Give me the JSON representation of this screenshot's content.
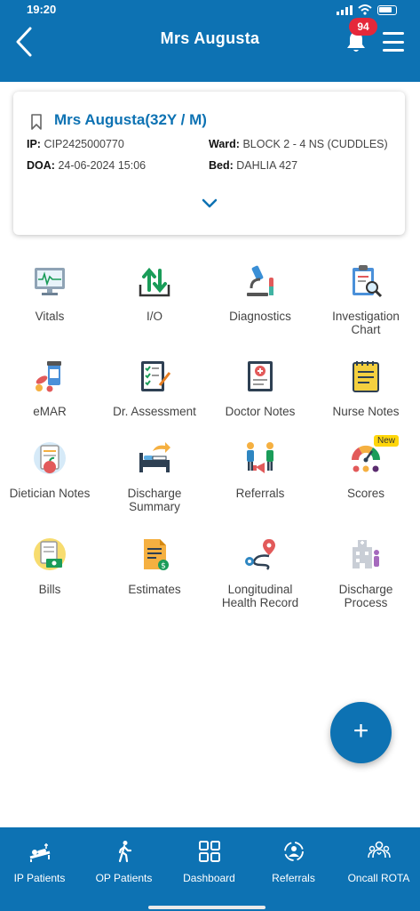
{
  "status_bar": {
    "time": "19:20"
  },
  "header": {
    "title": "Mrs Augusta",
    "notification_count": "94"
  },
  "patient": {
    "name": "Mrs Augusta(32Y / M)",
    "ip_label": "IP:",
    "ip_value": "CIP2425000770",
    "ward_label": "Ward:",
    "ward_value": "BLOCK 2 - 4 NS (CUDDLES)",
    "doa_label": "DOA:",
    "doa_value": "24-06-2024 15:06",
    "bed_label": "Bed:",
    "bed_value": "DAHLIA 427"
  },
  "grid": {
    "vitals": "Vitals",
    "io": "I/O",
    "diagnostics": "Diagnostics",
    "investigation_chart_1": "Investigation",
    "investigation_chart_2": "Chart",
    "emar": "eMAR",
    "dr_assessment": "Dr. Assessment",
    "doctor_notes": "Doctor Notes",
    "nurse_notes": "Nurse Notes",
    "dietician_notes": "Dietician Notes",
    "discharge_summary_1": "Discharge",
    "discharge_summary_2": "Summary",
    "referrals": "Referrals",
    "scores": "Scores",
    "scores_badge": "New",
    "bills": "Bills",
    "estimates": "Estimates",
    "longitudinal_1": "Longitudinal",
    "longitudinal_2": "Health Record",
    "discharge_process_1": "Discharge",
    "discharge_process_2": "Process"
  },
  "fab": {
    "label": "+"
  },
  "bottom_nav": {
    "ip_patients": "IP Patients",
    "op_patients": "OP Patients",
    "dashboard": "Dashboard",
    "referrals": "Referrals",
    "oncall_rota": "Oncall ROTA"
  },
  "colors": {
    "primary": "#0d72b3",
    "badge_red": "#e5283a",
    "new_badge": "#ffd60a"
  }
}
